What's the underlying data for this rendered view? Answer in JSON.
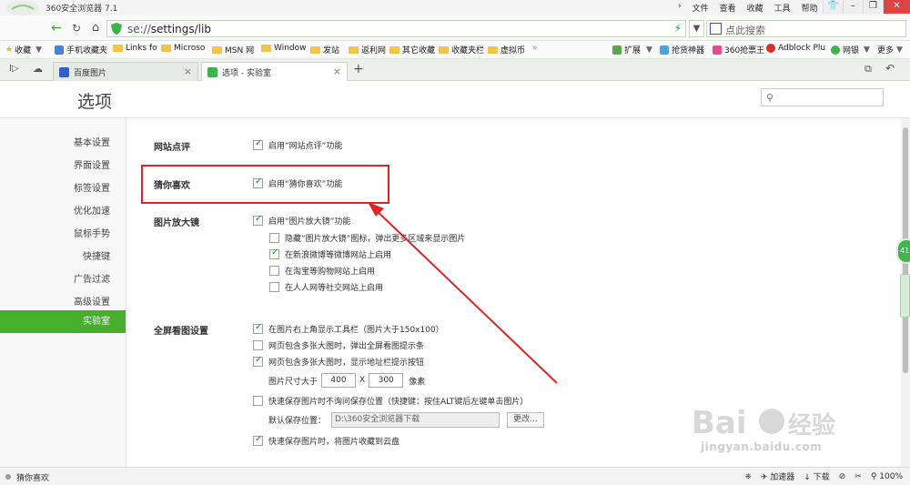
{
  "window": {
    "title": "360安全浏览器 7.1",
    "menu": [
      "文件",
      "查看",
      "收藏",
      "工具",
      "帮助"
    ]
  },
  "address": {
    "prefix": "se://",
    "path": "settings/lib",
    "search_placeholder": "点此搜索"
  },
  "bookmarks": [
    "收藏",
    "手机收藏夹",
    "Links fo",
    "Microso",
    "MSN 网",
    "Window",
    "发站",
    "返利网",
    "其它收藏",
    "收藏夹栏",
    "虚拟币",
    "扩展",
    "抢货神器",
    "360抢票王",
    "Adblock Plu",
    "网银",
    "更多"
  ],
  "tabs": [
    {
      "label": "百度图片"
    },
    {
      "label": "选项 - 实验室"
    }
  ],
  "page": {
    "title": "选项"
  },
  "sidenav": [
    "基本设置",
    "界面设置",
    "标签设置",
    "优化加速",
    "鼠标手势",
    "快捷键",
    "广告过滤",
    "高级设置",
    "实验室"
  ],
  "sections": {
    "review": {
      "title": "网站点评",
      "opt": "启用“网站点评”功能",
      "checked": true
    },
    "guess": {
      "title": "猜你喜欢",
      "opt": "启用“猜你喜欢”功能",
      "checked": true
    },
    "magnifier": {
      "title": "图片放大镜",
      "main": "启用“图片放大镜”功能",
      "subs": [
        {
          "label": "隐藏“图片放大镜”图标，弹出更多区域来显示图片",
          "checked": false
        },
        {
          "label": "在新浪微博等微博网站上启用",
          "checked": true
        },
        {
          "label": "在淘宝等购物网站上启用",
          "checked": false
        },
        {
          "label": "在人人网等社交网站上启用",
          "checked": false
        }
      ]
    },
    "fullscreen": {
      "title": "全屏看图设置",
      "opt1": "在图片右上角显示工具栏（图片大于150x100）",
      "opt2": "网页包含多张大图时，弹出全屏看图提示条",
      "opt3": "网页包含多张大图时，显示地址栏提示按钮",
      "size_label": "图片尺寸大于",
      "size_w": "400",
      "size_x": "X",
      "size_h": "300",
      "size_unit": "像素",
      "opt4": "快速保存图片时不询问保存位置（快捷键：按住ALT键后左键单击图片）",
      "save_label": "默认保存位置：",
      "save_path": "D:\\360安全浏览器下载",
      "change_btn": "更改...",
      "opt5": "快速保存图片时，将图片收藏到云盘"
    }
  },
  "status": {
    "left": "猜你喜欢",
    "accelerator": "加速器",
    "download": "下载",
    "zoom": "100%"
  },
  "watermark": {
    "text": "jingyan.baidu.com"
  },
  "colors": {
    "accent": "#46b02c",
    "highlight": "#e12323"
  }
}
